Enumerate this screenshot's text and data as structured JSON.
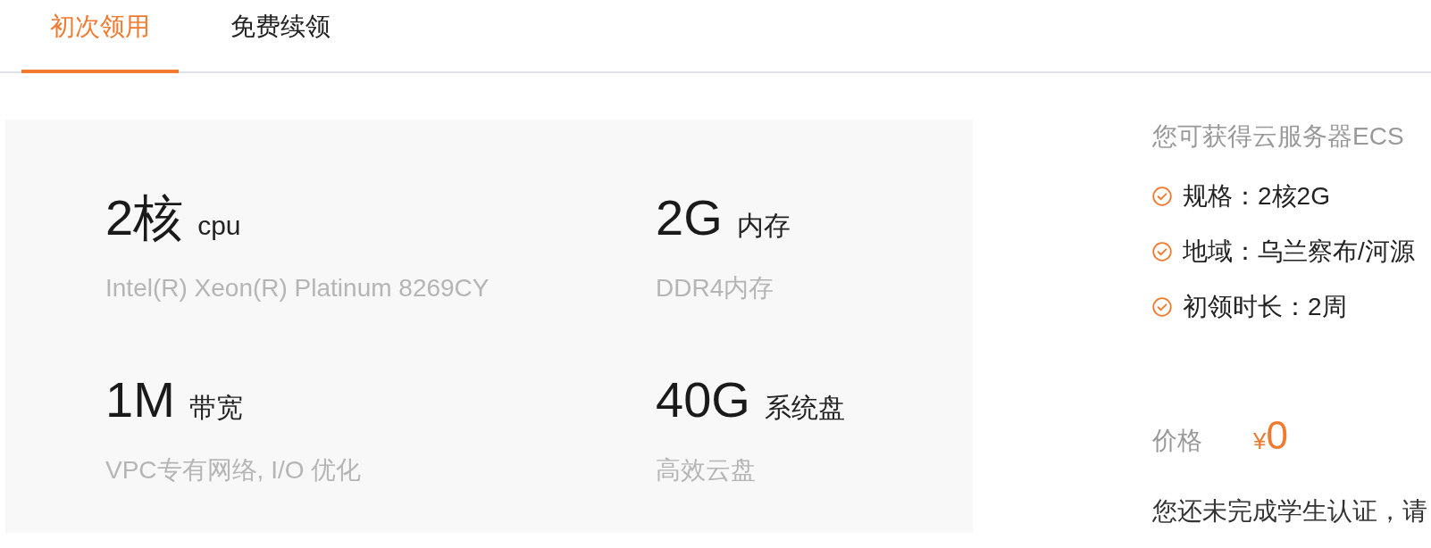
{
  "tabs": [
    {
      "label": "初次领用",
      "selected": true
    },
    {
      "label": "免费续领",
      "selected": false
    }
  ],
  "specs": [
    {
      "value": "2核",
      "unit": "cpu",
      "detail": "Intel(R) Xeon(R) Platinum 8269CY"
    },
    {
      "value": "2G",
      "unit": "内存",
      "detail": "DDR4内存"
    },
    {
      "value": "1M",
      "unit": "带宽",
      "detail": "VPC专有网络, I/O 优化"
    },
    {
      "value": "40G",
      "unit": "系统盘",
      "detail": "高效云盘"
    }
  ],
  "summary": {
    "title": "您可获得云服务器ECS",
    "items": [
      "规格：2核2G",
      "地域：乌兰察布/河源",
      "初领时长：2周"
    ]
  },
  "price": {
    "label": "价格",
    "currency": "¥",
    "amount": "0"
  },
  "notice": "您还未完成学生认证，请"
}
